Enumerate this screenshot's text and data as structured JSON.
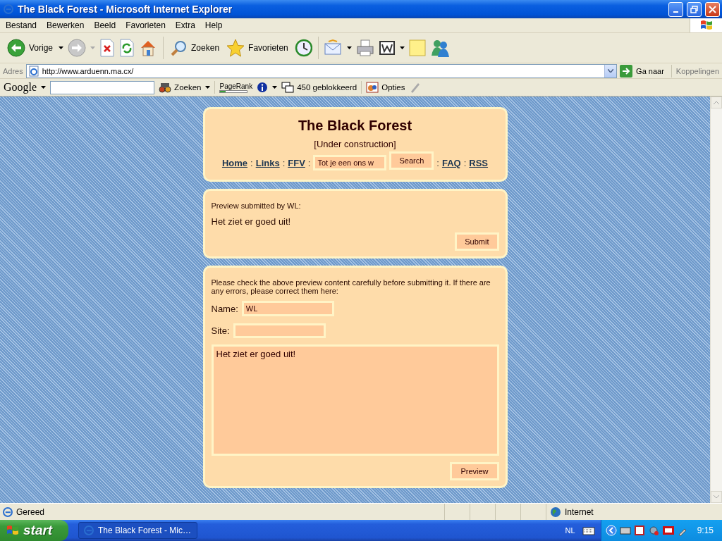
{
  "window": {
    "title": "The Black Forest - Microsoft Internet Explorer"
  },
  "menu": [
    "Bestand",
    "Bewerken",
    "Beeld",
    "Favorieten",
    "Extra",
    "Help"
  ],
  "toolbar": {
    "back": "Vorige",
    "search": "Zoeken",
    "favorites": "Favorieten"
  },
  "address": {
    "label": "Adres",
    "url": "http://www.arduenn.ma.cx/",
    "go": "Ga naar",
    "links": "Koppelingen"
  },
  "google_bar": {
    "logo": "Google",
    "search": "Zoeken",
    "pagerank": {
      "label": "PageRank",
      "level": 0.2
    },
    "blocked": "450 geblokkeerd",
    "options": "Opties"
  },
  "site": {
    "title": "The Black Forest",
    "subtitle": "[Under construction]",
    "nav": [
      {
        "kind": "link",
        "text": "Home"
      },
      {
        "kind": "separator",
        "text": ":"
      },
      {
        "kind": "link",
        "text": "Links"
      },
      {
        "kind": "separator",
        "text": ":"
      },
      {
        "kind": "link",
        "text": "FFV"
      },
      {
        "kind": "separator",
        "text": ":"
      },
      {
        "kind": "field",
        "value": "Tot je een ons w"
      },
      {
        "kind": "button",
        "text": "Search"
      },
      {
        "kind": "separator",
        "text": ":"
      },
      {
        "kind": "link",
        "text": "FAQ"
      },
      {
        "kind": "separator",
        "text": ":"
      },
      {
        "kind": "link",
        "text": "RSS"
      }
    ]
  },
  "preview": {
    "label": "Preview submitted by WL:",
    "text": "Het ziet er goed uit!",
    "button": "Submit"
  },
  "form": {
    "intro": "Please check the above preview content carefully before submitting it. If there are any errors, please correct them here:",
    "name_label": "Name:",
    "name_value": "WL",
    "site_label": "Site:",
    "message": "Het ziet er goed uit!",
    "button": "Preview"
  },
  "status_bar": {
    "text": "Gereed",
    "zone": "Internet"
  },
  "taskbar": {
    "start": "start",
    "task": "The Black Forest - Mic…",
    "language": "NL",
    "clock": "9:15"
  }
}
